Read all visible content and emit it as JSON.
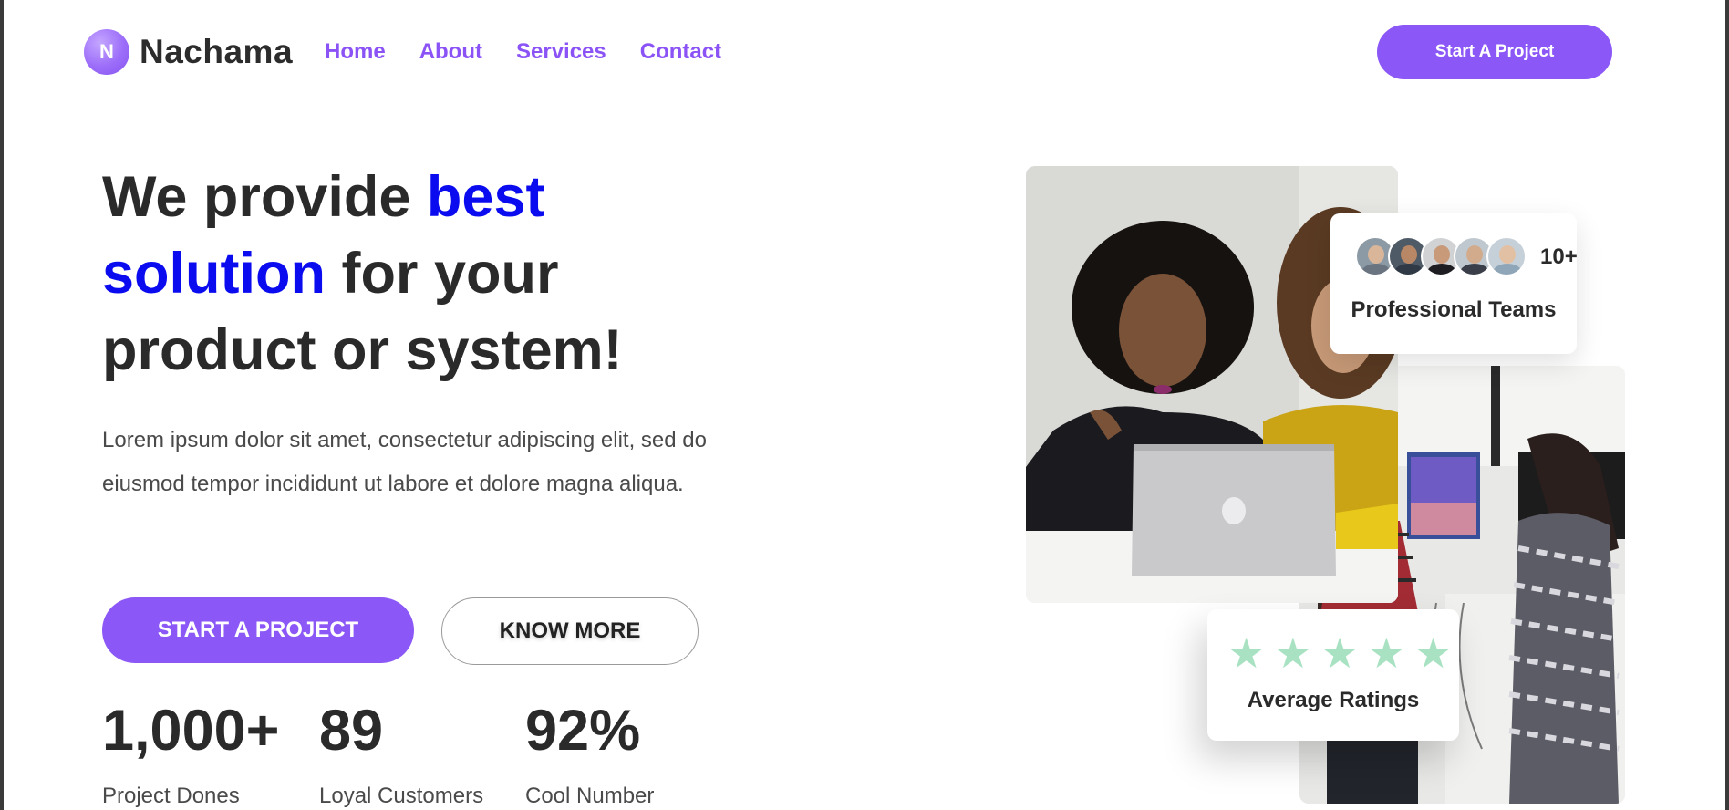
{
  "brand": {
    "initial": "N",
    "name": "Nachama",
    "accent": "#8b57f6",
    "highlight": "#0b0bf0"
  },
  "nav": {
    "items": [
      "Home",
      "About",
      "Services",
      "Contact"
    ]
  },
  "header": {
    "cta_label": "Start A Project"
  },
  "hero": {
    "headline_part1": "We provide ",
    "headline_highlight": "best solution",
    "headline_part2": " for your product or system!",
    "description": "Lorem ipsum dolor sit amet, consectetur adipiscing elit, sed do eiusmod tempor incididunt ut labore et dolore magna aliqua.",
    "primary_button": "START A PROJECT",
    "secondary_button": "KNOW MORE"
  },
  "stats": [
    {
      "value": "1,000+",
      "label": "Project Dones"
    },
    {
      "value": "89",
      "label": "Loyal Customers"
    },
    {
      "value": "92%",
      "label": "Cool Number"
    }
  ],
  "teams_card": {
    "count": "10+",
    "label": "Professional Teams",
    "avatar_count": 5
  },
  "ratings_card": {
    "stars": 5,
    "label": "Average Ratings",
    "star_color": "#a8e2c2"
  }
}
